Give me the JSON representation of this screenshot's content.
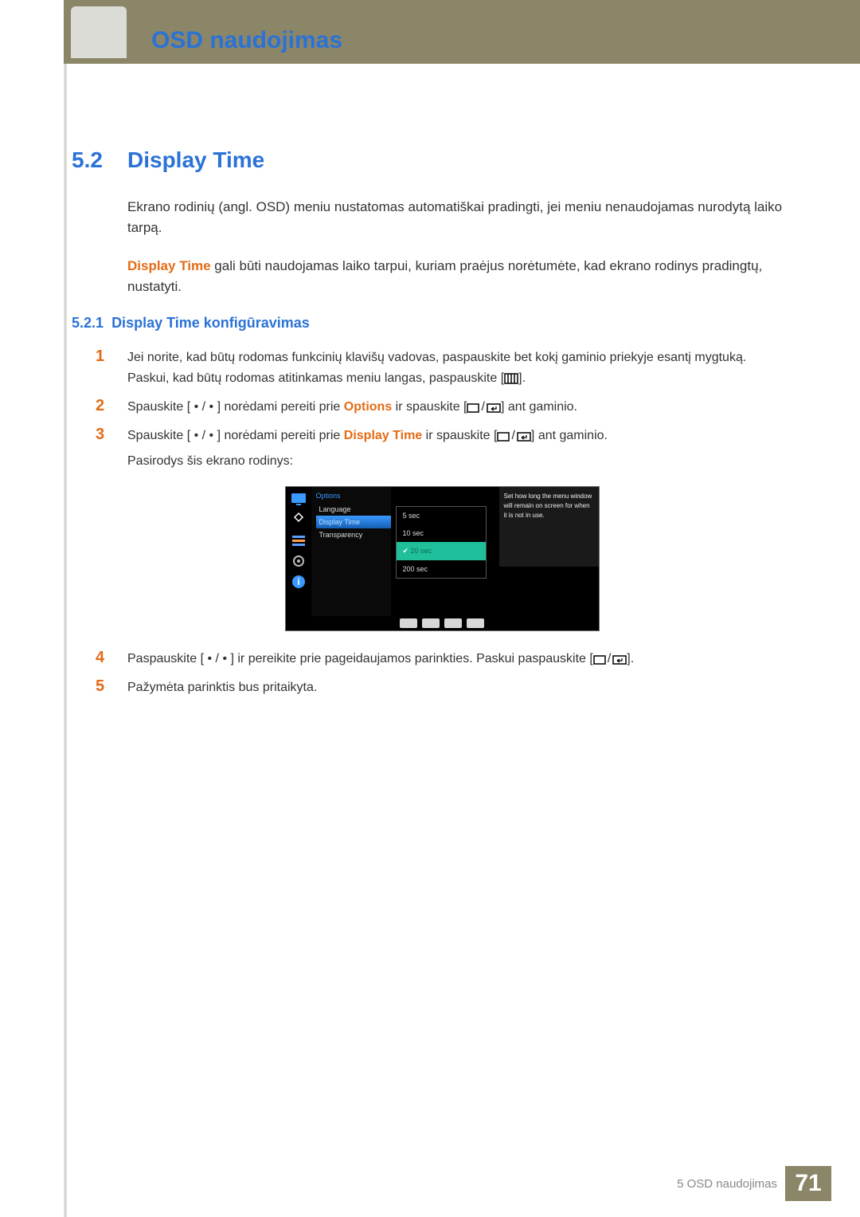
{
  "header": {
    "chapter_title": "OSD naudojimas"
  },
  "section": {
    "num": "5.2",
    "title": "Display Time"
  },
  "intro": {
    "p1": "Ekrano rodinių (angl. OSD) meniu nustatomas automatiškai pradingti, jei meniu nenaudojamas nurodytą laiko tarpą.",
    "p2_strong": "Display Time",
    "p2_rest": " gali būti naudojamas laiko tarpui, kuriam praėjus norėtumėte, kad ekrano rodinys pradingtų, nustatyti."
  },
  "subsection": {
    "num": "5.2.1",
    "title": "Display Time konfigūravimas"
  },
  "steps": [
    {
      "n": "1",
      "a": "Jei norite, kad būtų rodomas funkcinių klavišų vadovas, paspauskite bet kokį gaminio priekyje esantį mygtuką. Paskui, kad būtų rodomas atitinkamas meniu langas, paspauskite [",
      "b": "",
      "c": "].",
      "icon": "menu",
      "split": false
    },
    {
      "n": "2",
      "a": "Spauskite [ • / • ] norėdami pereiti prie ",
      "b": "Options",
      "c": " ir spauskite [",
      "d": "] ant gaminio.",
      "icon": "src-enter",
      "split": true
    },
    {
      "n": "3",
      "a": "Spauskite [ • / • ] norėdami pereiti prie ",
      "b": "Display Time",
      "c": " ir spauskite [",
      "d": "] ant gaminio.",
      "e": "Pasirodys šis ekrano rodinys:",
      "icon": "src-enter",
      "split": true
    },
    {
      "n": "4",
      "a": "Paspauskite [ • / • ] ir pereikite prie pageidaujamos parinkties. Paskui paspauskite [",
      "b": "",
      "c": "].",
      "icon": "src-enter",
      "split": false
    },
    {
      "n": "5",
      "a": "Pažymėta parinktis bus pritaikyta.",
      "b": "",
      "c": "",
      "icon": "none",
      "split": false
    }
  ],
  "osd": {
    "header": "Options",
    "left_items": [
      "Language",
      "Display Time",
      "Transparency"
    ],
    "left_selected_index": 1,
    "sub_items": [
      "5 sec",
      "10 sec",
      "20 sec",
      "200 sec"
    ],
    "sub_selected_index": 2,
    "help_text": "Set how long the menu window will remain on screen for when it is not in use."
  },
  "footer": {
    "text": "5 OSD naudojimas",
    "page": "71"
  }
}
